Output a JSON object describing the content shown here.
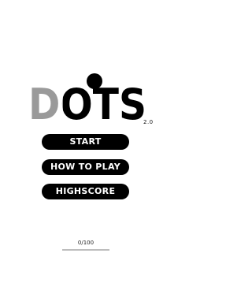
{
  "app": {
    "title_letters": [
      "D",
      "O",
      "T",
      "S"
    ],
    "version": "2.0"
  },
  "menu": {
    "start_label": "START",
    "how_to_play_label": "HOW TO PLAY",
    "highscore_label": "HIGHSCORE"
  },
  "progress": {
    "text": "0/100",
    "current": 0,
    "total": 100
  },
  "colors": {
    "logo_gray": "#9a9a9a",
    "logo_black": "#000000",
    "button_bg": "#000000",
    "button_text": "#ffffff",
    "background": "#ffffff"
  }
}
